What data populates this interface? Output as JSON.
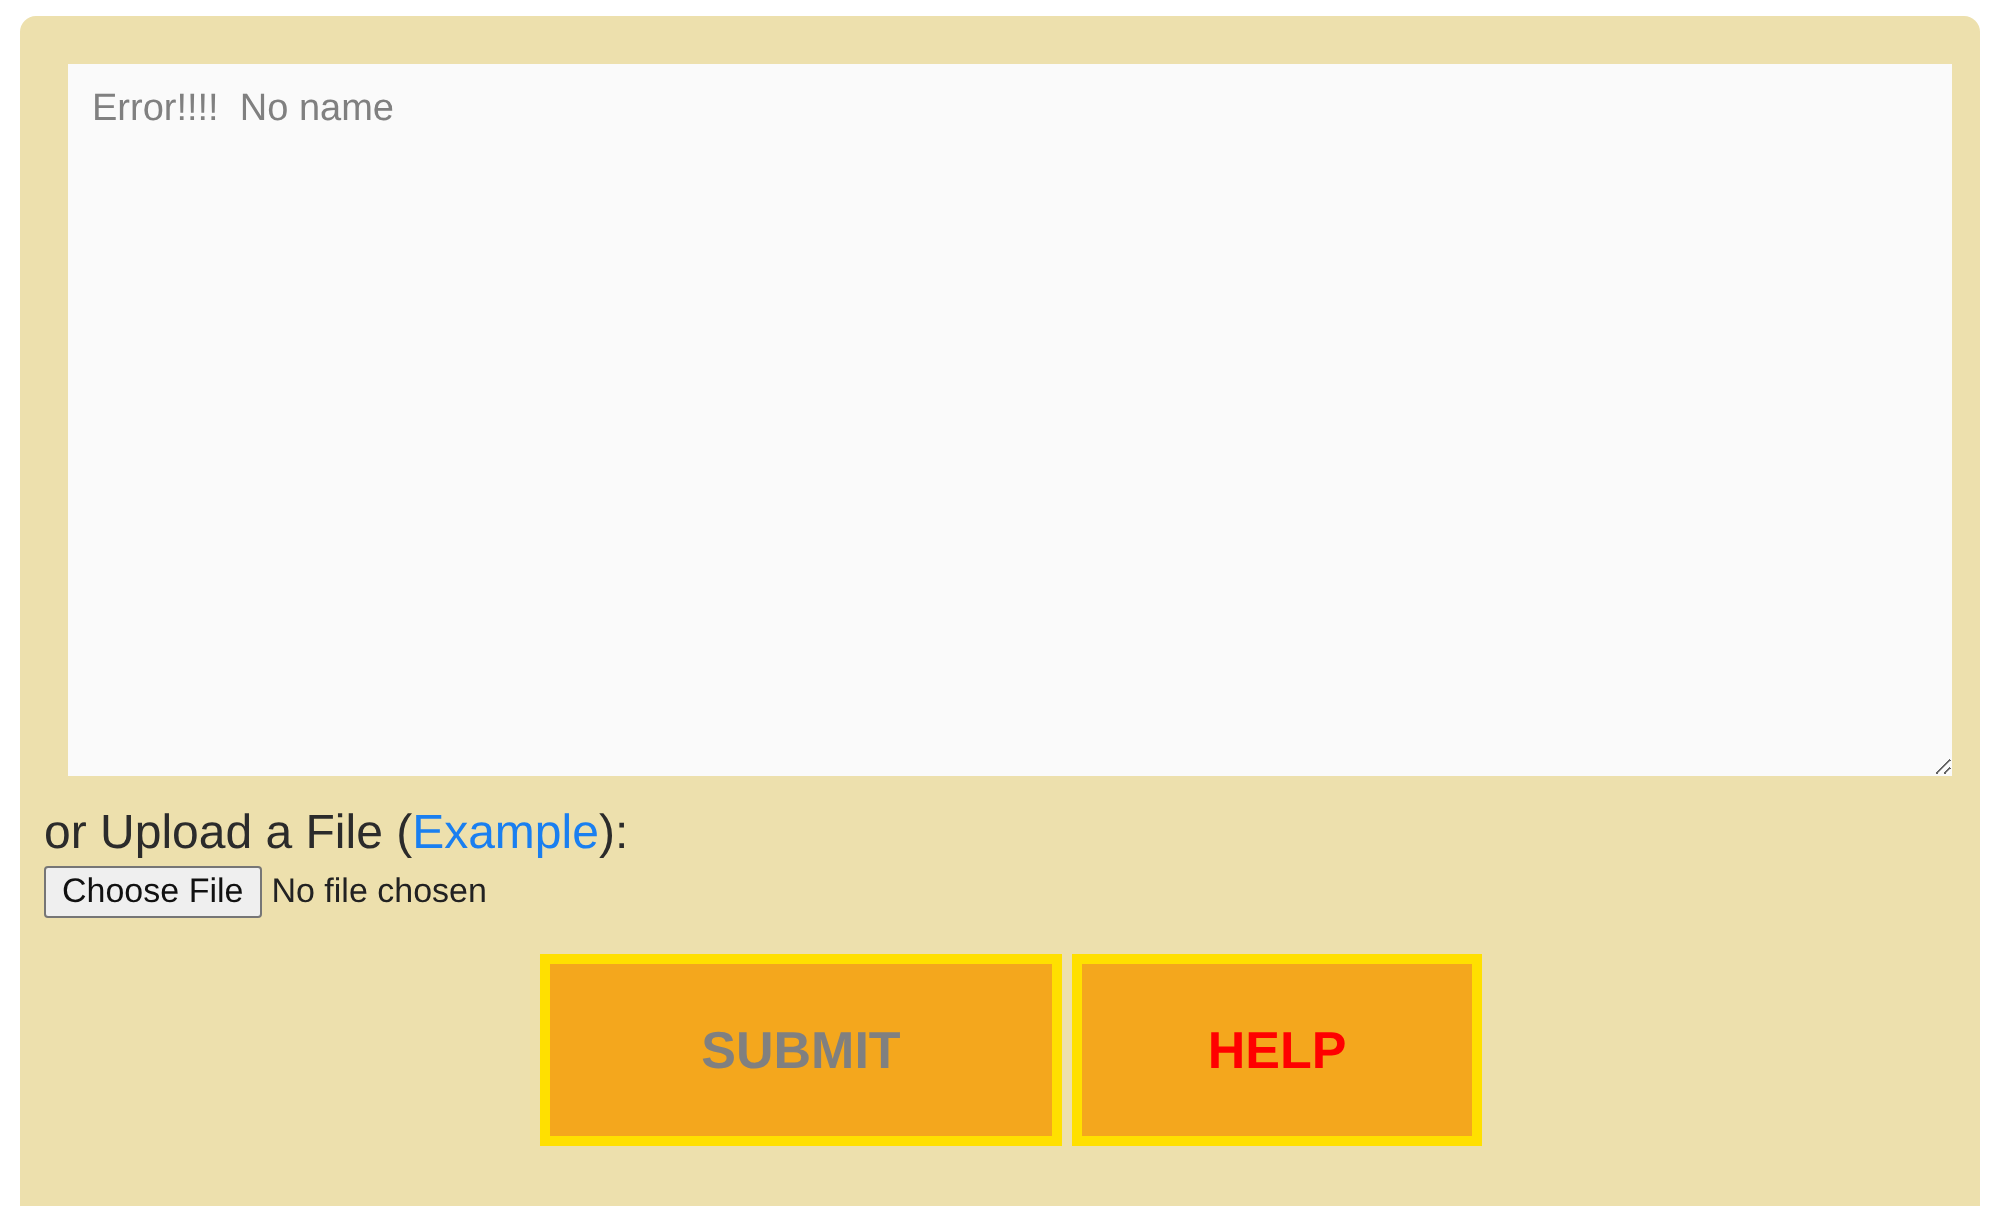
{
  "input": {
    "placeholder": "Error!!!!  No name"
  },
  "upload": {
    "label_before": "or Upload a File (",
    "link": "Example",
    "label_after": "):",
    "button": "Choose File",
    "status": "No file chosen"
  },
  "buttons": [
    {
      "label": "SUBMIT",
      "kind": "submit"
    },
    {
      "label": "HELP",
      "kind": "help"
    }
  ]
}
